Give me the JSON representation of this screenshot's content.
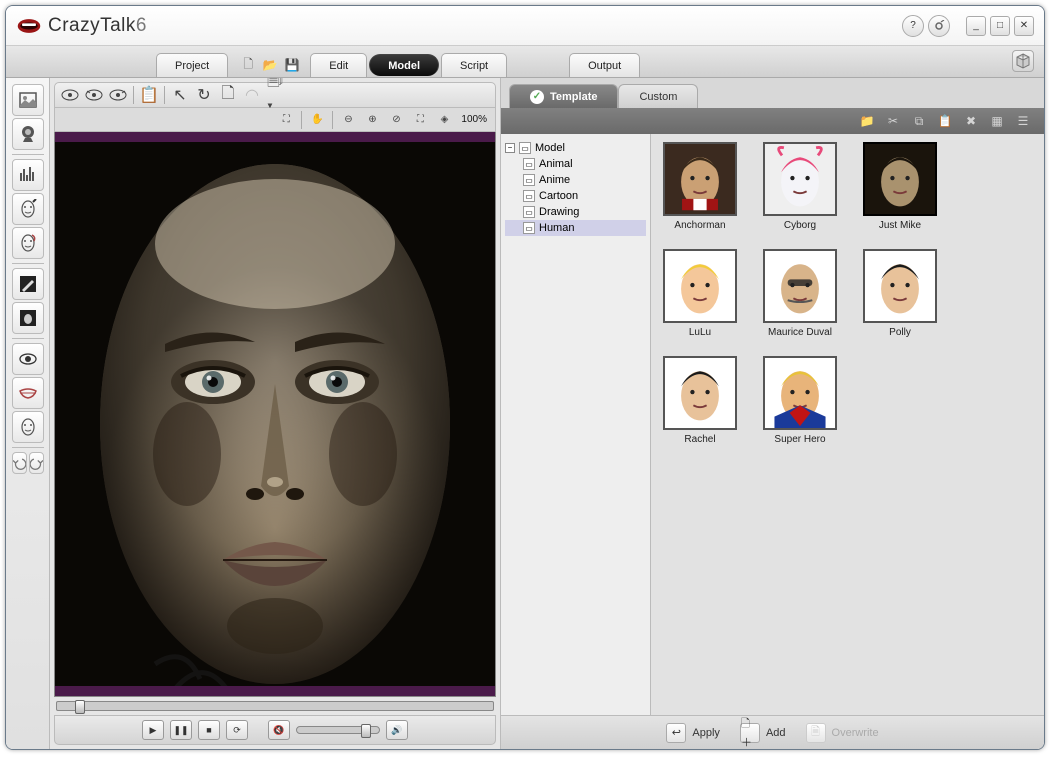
{
  "app": {
    "title": "CrazyTalk",
    "version": "6"
  },
  "windowButtons": {
    "help": "?",
    "tool": "⚙",
    "min": "_",
    "max": "□",
    "close": "✕"
  },
  "mainTabs": {
    "project": "Project",
    "edit": "Edit",
    "model": "Model",
    "script": "Script",
    "output": "Output",
    "active": "model"
  },
  "viewer": {
    "zoom": "100%"
  },
  "leftTools": [
    "image-import",
    "webcam",
    "audio-spectrum",
    "face-fitting-edit",
    "face-fitting-auto",
    "mask-brush",
    "background",
    "eye-settings",
    "teeth-settings",
    "head-settings",
    "undo",
    "redo"
  ],
  "libraryTabs": {
    "template": "Template",
    "custom": "Custom",
    "active": "template"
  },
  "tree": {
    "root": "Model",
    "items": [
      "Animal",
      "Anime",
      "Cartoon",
      "Drawing",
      "Human"
    ],
    "selected": "Human"
  },
  "thumbnails": [
    {
      "name": "Anchorman",
      "palette": "warm"
    },
    {
      "name": "Cyborg",
      "palette": "white"
    },
    {
      "name": "Just Mike",
      "palette": "sepia",
      "selected": true
    },
    {
      "name": "LuLu",
      "palette": "blonde"
    },
    {
      "name": "Maurice Duval",
      "palette": "bald"
    },
    {
      "name": "Polly",
      "palette": "dark"
    },
    {
      "name": "Rachel",
      "palette": "dark"
    },
    {
      "name": "Super Hero",
      "palette": "hero"
    }
  ],
  "footer": {
    "apply": "Apply",
    "add": "Add",
    "overwrite": "Overwrite"
  }
}
